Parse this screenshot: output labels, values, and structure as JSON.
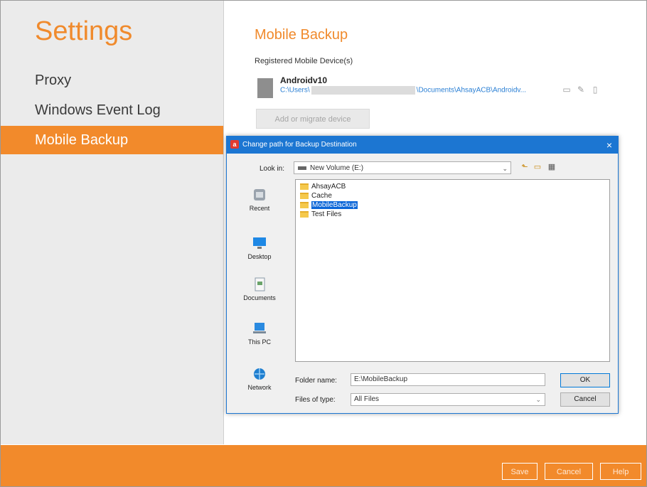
{
  "sidebar": {
    "title": "Settings",
    "items": [
      {
        "label": "Proxy"
      },
      {
        "label": "Windows Event Log"
      },
      {
        "label": "Mobile Backup"
      }
    ]
  },
  "main": {
    "title": "Mobile Backup",
    "registered_label": "Registered Mobile Device(s)",
    "device": {
      "name": "Androidv10",
      "path_start": "C:\\Users\\",
      "path_end": "\\Documents\\AhsayACB\\Androidv..."
    },
    "add_button": "Add or migrate device"
  },
  "dialog": {
    "title": "Change path for Backup Destination",
    "close": "×",
    "look_in_label": "Look in:",
    "look_in_value": "New Volume (E:)",
    "places": [
      {
        "label": "Recent"
      },
      {
        "label": "Desktop"
      },
      {
        "label": "Documents"
      },
      {
        "label": "This PC"
      },
      {
        "label": "Network"
      }
    ],
    "files": [
      {
        "name": "AhsayACB"
      },
      {
        "name": "Cache"
      },
      {
        "name": "MobileBackup"
      },
      {
        "name": "Test Files"
      }
    ],
    "folder_name_label": "Folder name:",
    "folder_name_value": "E:\\MobileBackup",
    "files_of_type_label": "Files of type:",
    "files_of_type_value": "All Files",
    "ok": "OK",
    "cancel": "Cancel"
  },
  "footer": {
    "save": "Save",
    "cancel": "Cancel",
    "help": "Help"
  },
  "colors": {
    "accent": "#f28a2b",
    "dialog_blue": "#1c76d2",
    "selection": "#0b66d8"
  }
}
